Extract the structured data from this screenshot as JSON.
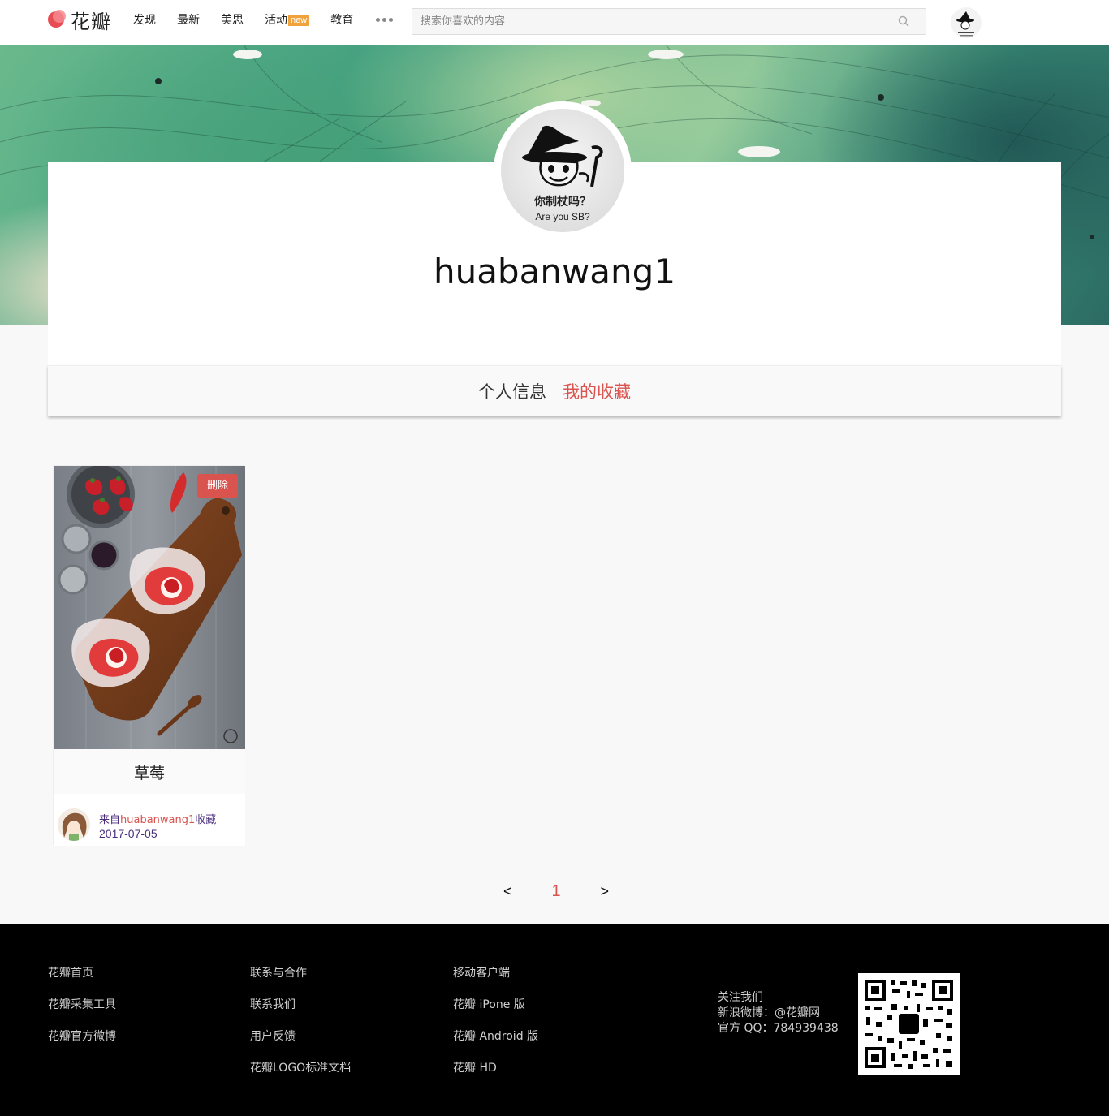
{
  "header": {
    "logo_text": "花瓣",
    "nav": [
      {
        "label": "发现"
      },
      {
        "label": "最新"
      },
      {
        "label": "美思"
      },
      {
        "label": "活动",
        "badge": "new"
      },
      {
        "label": "教育"
      }
    ],
    "search_placeholder": "搜索你喜欢的内容"
  },
  "profile": {
    "avatar_caption_cn": "你制杖吗？",
    "avatar_caption_en": "Are you SB?",
    "username": "huabanwang1"
  },
  "tabs": [
    {
      "label": "个人信息",
      "active": false
    },
    {
      "label": "我的收藏",
      "active": true
    }
  ],
  "pins": [
    {
      "delete_label": "删除",
      "title": "草莓",
      "from_prefix": "来自",
      "from_user": "huabanwang1",
      "from_suffix": "收藏",
      "date": "2017-07-05"
    }
  ],
  "pager": {
    "prev": "<",
    "current": "1",
    "next": ">"
  },
  "footer": {
    "col1": [
      "花瓣首页",
      "花瓣采集工具",
      "花瓣官方微博"
    ],
    "col2": [
      "联系与合作",
      "联系我们",
      "用户反馈",
      "花瓣LOGO标准文档"
    ],
    "col3": [
      "移动客户端",
      "花瓣 iPone 版",
      "花瓣 Android 版",
      "花瓣 HD"
    ],
    "follow": [
      "关注我们",
      "新浪微博：@花瓣网",
      "官方 QQ：784939438"
    ]
  },
  "colors": {
    "accent": "#d9534f",
    "badge": "#f0a23c",
    "footer_bg": "#000000"
  }
}
